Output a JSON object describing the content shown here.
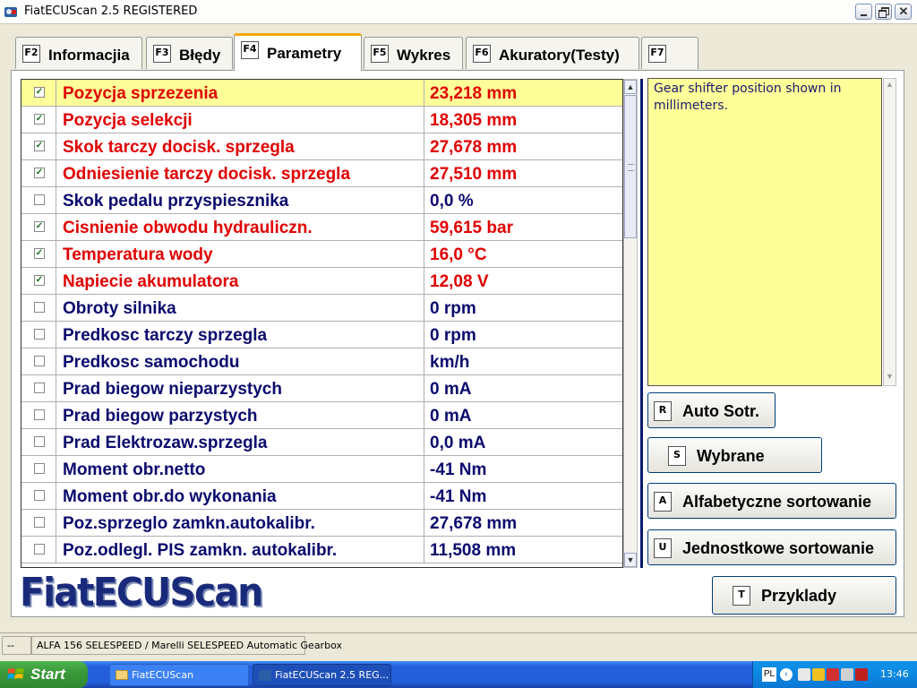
{
  "window": {
    "title": "FiatECUScan 2.5 REGISTERED"
  },
  "tabs": [
    {
      "key": "F2",
      "label": "Informacjia"
    },
    {
      "key": "F3",
      "label": "Błędy"
    },
    {
      "key": "F4",
      "label": "Parametry",
      "active": true
    },
    {
      "key": "F5",
      "label": "Wykres"
    },
    {
      "key": "F6",
      "label": "Akuratory(Testy)"
    },
    {
      "key": "F7",
      "label": ""
    }
  ],
  "parameters": [
    {
      "checked": true,
      "name": "Pozycja sprzezenia",
      "value": "23,218 mm",
      "color": "red",
      "selected": true
    },
    {
      "checked": true,
      "name": "Pozycja selekcji",
      "value": "18,305 mm",
      "color": "red"
    },
    {
      "checked": true,
      "name": "Skok tarczy docisk. sprzegla",
      "value": "27,678 mm",
      "color": "red"
    },
    {
      "checked": true,
      "name": "Odniesienie tarczy docisk. sprzegla",
      "value": "27,510 mm",
      "color": "red"
    },
    {
      "checked": false,
      "name": "Skok pedalu przyspiesznika",
      "value": "0,0 %",
      "color": "blue"
    },
    {
      "checked": true,
      "name": "Cisnienie obwodu hydrauliczn.",
      "value": "59,615 bar",
      "color": "red"
    },
    {
      "checked": true,
      "name": "Temperatura wody",
      "value": "16,0 °C",
      "color": "red"
    },
    {
      "checked": true,
      "name": "Napiecie akumulatora",
      "value": "12,08 V",
      "color": "red"
    },
    {
      "checked": false,
      "name": "Obroty silnika",
      "value": "0 rpm",
      "color": "blue"
    },
    {
      "checked": false,
      "name": "Predkosc tarczy sprzegla",
      "value": "0 rpm",
      "color": "blue"
    },
    {
      "checked": false,
      "name": "Predkosc samochodu",
      "value": " km/h",
      "color": "blue"
    },
    {
      "checked": false,
      "name": "Prad biegow nieparzystych",
      "value": "0 mA",
      "color": "blue"
    },
    {
      "checked": false,
      "name": "Prad biegow parzystych",
      "value": "0 mA",
      "color": "blue"
    },
    {
      "checked": false,
      "name": "Prad Elektrozaw.sprzegla",
      "value": "0,0 mA",
      "color": "blue"
    },
    {
      "checked": false,
      "name": "Moment obr.netto",
      "value": "-41 Nm",
      "color": "blue"
    },
    {
      "checked": false,
      "name": "Moment obr.do wykonania",
      "value": "-41 Nm",
      "color": "blue"
    },
    {
      "checked": false,
      "name": "Poz.sprzeglo zamkn.autokalibr.",
      "value": "27,678 mm",
      "color": "blue"
    },
    {
      "checked": false,
      "name": "Poz.odlegl. PIS zamkn. autokalibr.",
      "value": "11,508 mm",
      "color": "blue"
    }
  ],
  "description": "Gear shifter position shown in millimeters.",
  "buttons": {
    "auto_sort": {
      "key": "R",
      "label": "Auto Sotr."
    },
    "selected": {
      "key": "S",
      "label": "Wybrane"
    },
    "alpha_sort": {
      "key": "A",
      "label": "Alfabetyczne sortowanie"
    },
    "unit_sort": {
      "key": "U",
      "label": "Jednostkowe sortowanie"
    },
    "examples": {
      "key": "T",
      "label": "Przyklady"
    }
  },
  "logo": "FiatECUScan",
  "statusbar": {
    "cell1": "--",
    "cell2": "ALFA 156 SELESPEED / Marelli SELESPEED Automatic Gearbox"
  },
  "taskbar": {
    "start": "Start",
    "items": [
      "FiatECUScan",
      "FiatECUScan 2.5 REG..."
    ],
    "lang": "PL",
    "clock": "13:46"
  },
  "colors": {
    "red": "#e00000",
    "blue": "#0a0a6e",
    "selected_bg": "#ffff99",
    "accent": "#f7a800"
  }
}
